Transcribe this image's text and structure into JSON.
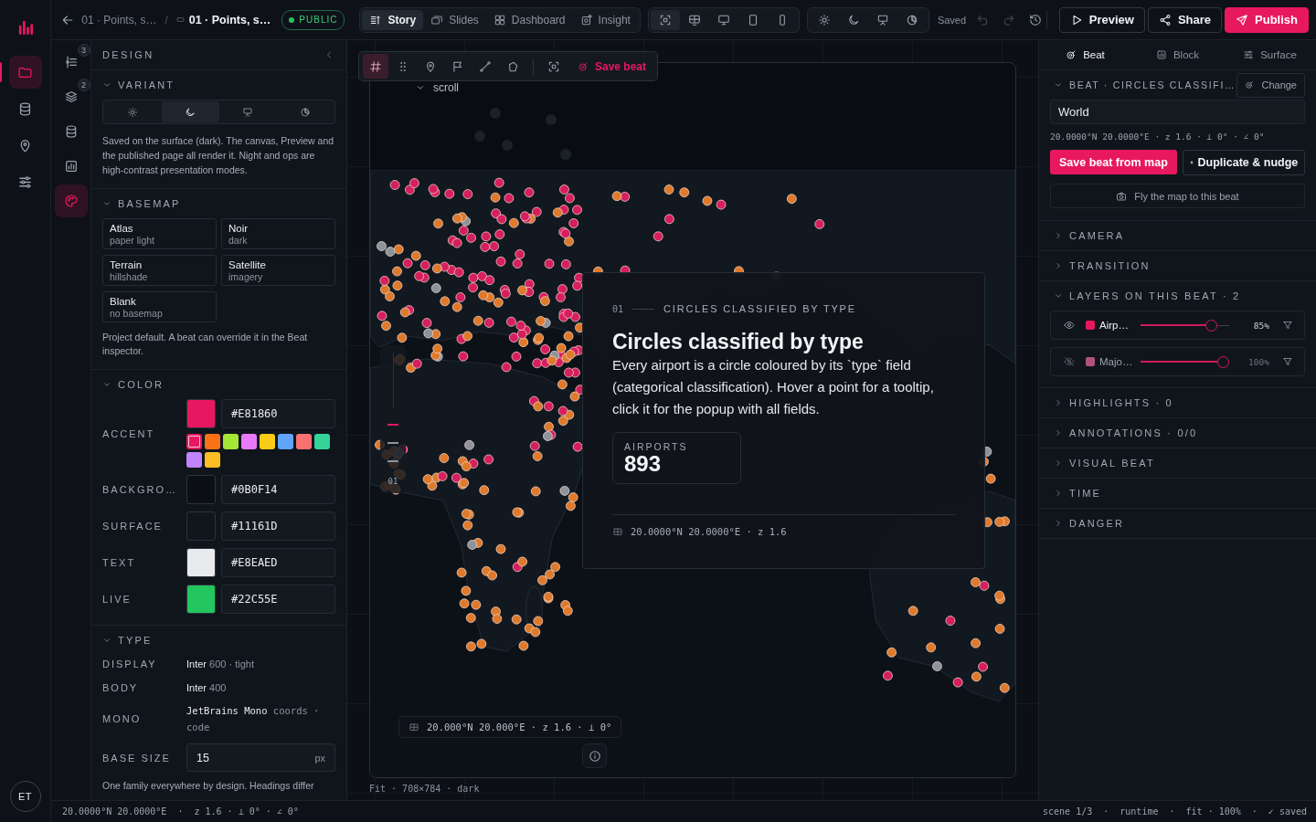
{
  "rail": {
    "items": [
      {
        "selected": true
      },
      {
        "selected": false
      },
      {
        "selected": false
      },
      {
        "selected": false
      }
    ],
    "avatar": "ET"
  },
  "topbar": {
    "parent": "01 · Points, s…",
    "separator": "/",
    "title": "01 · Points, s…",
    "badge": "PUBLIC",
    "modes": [
      {
        "label": "Story",
        "selected": true
      },
      {
        "label": "Slides",
        "selected": false
      },
      {
        "label": "Dashboard",
        "selected": false
      },
      {
        "label": "Insight",
        "selected": false
      }
    ],
    "devices": [
      {
        "selected": true
      },
      {
        "selected": false
      },
      {
        "selected": false
      },
      {
        "selected": false
      },
      {
        "selected": false
      }
    ],
    "save_state": "Saved",
    "undo": {
      "disabled": true
    },
    "redo": {
      "disabled": true
    },
    "actions": [
      {
        "kind": "preview",
        "label": "Preview"
      },
      {
        "kind": "share",
        "label": "Share"
      },
      {
        "kind": "publish",
        "label": "Publish"
      }
    ]
  },
  "tool_rail": [
    {
      "badge": "3",
      "selected": false
    },
    {
      "badge": "2",
      "selected": false
    },
    {
      "selected": false
    },
    {
      "selected": false
    },
    {
      "selected": true
    }
  ],
  "design": {
    "title": "DESIGN",
    "variant": {
      "title": "VARIANT",
      "expanded": true,
      "options": [
        {
          "selected": false
        },
        {
          "selected": true
        },
        {
          "selected": false
        },
        {
          "selected": false
        }
      ],
      "note": "Saved on the surface (dark). The canvas, Preview and the published page all render it. Night and ops are high-contrast presentation modes."
    },
    "basemap": {
      "title": "BASEMAP",
      "expanded": true,
      "options": [
        {
          "name": "Atlas",
          "detail": "paper light"
        },
        {
          "name": "Noir",
          "detail": "dark"
        },
        {
          "name": "Terrain",
          "detail": "hillshade"
        },
        {
          "name": "Satellite",
          "detail": "imagery"
        },
        {
          "name": "Blank",
          "detail": "no basemap"
        }
      ],
      "note": "Project default. A beat can override it in the Beat inspector."
    },
    "color": {
      "title": "COLOR",
      "expanded": true,
      "rows": [
        {
          "label": "ACCENT",
          "value": "#E81860",
          "color": "#e81860"
        },
        {
          "label": "BACKGRO…",
          "value": "#0B0F14",
          "color": "#0b0f14"
        },
        {
          "label": "SURFACE",
          "value": "#11161D",
          "color": "#11161d"
        },
        {
          "label": "TEXT",
          "value": "#E8EAED",
          "color": "#e8eaed"
        },
        {
          "label": "LIVE",
          "value": "#22C55E",
          "color": "#22c55e"
        }
      ],
      "palette": [
        {
          "color": "#e81860",
          "selected": true
        },
        {
          "color": "#f97316",
          "selected": false
        },
        {
          "color": "#a3e635",
          "selected": false
        },
        {
          "color": "#e879f9",
          "selected": false
        },
        {
          "color": "#facc15",
          "selected": false
        },
        {
          "color": "#60a5fa",
          "selected": false
        },
        {
          "color": "#f87171",
          "selected": false
        },
        {
          "color": "#34d399",
          "selected": false
        },
        {
          "color": "#c084fc",
          "selected": false
        },
        {
          "color": "#fbbf24",
          "selected": false
        }
      ]
    },
    "type": {
      "title": "TYPE",
      "expanded": true,
      "rows": [
        {
          "label": "DISPLAY",
          "kind": "sans",
          "font": "Inter",
          "detail": "600 · tight"
        },
        {
          "label": "BODY",
          "kind": "sans",
          "font": "Inter",
          "detail": "400"
        },
        {
          "label": "MONO",
          "kind": "mono",
          "font": "JetBrains Mono",
          "detail": "coords · code"
        }
      ],
      "base_size": {
        "label": "BASE SIZE",
        "value": "15",
        "unit": "px"
      },
      "note": "One family everywhere by design. Headings differ"
    }
  },
  "canvas": {
    "tools": [
      {
        "selected": true
      },
      {
        "selected": false
      },
      {
        "selected": false
      },
      {
        "selected": false
      },
      {
        "selected": false
      },
      {
        "selected": false
      }
    ],
    "save_label": "Save beat",
    "scroll_label": "scroll",
    "steps": [
      {
        "selected": true
      },
      {
        "selected": false
      },
      {
        "selected": false
      }
    ],
    "step_label": "01",
    "card": {
      "index": "01",
      "eyebrow": "CIRCLES CLASSIFIED BY TYPE",
      "title": "Circles classified by type",
      "body": "Every airport is a circle coloured by its `type` field (categorical classification). Hover a point for a tooltip, click it for the popup with all fields.",
      "stat": {
        "label": "AIRPORTS",
        "value": "893"
      },
      "coords": "20.0000°N 20.0000°E · z 1.6"
    },
    "coords_pill": "20.000°N 20.000°E · z 1.6 · ⊥ 0°",
    "frame_info": "Fit · 708×784 · dark"
  },
  "inspector": {
    "tabs": [
      {
        "label": "Beat",
        "selected": true
      },
      {
        "label": "Block",
        "selected": false
      },
      {
        "label": "Surface",
        "selected": false
      }
    ],
    "beat": {
      "title": "BEAT · CIRCLES CLASSIFI…",
      "expanded": true,
      "change_label": "Change",
      "name": "World",
      "coords": "20.0000°N 20.0000°E · z 1.6 · ⊥ 0° · ∠ 0°",
      "save_label": "Save beat from map",
      "duplicate_label": "Duplicate & nudge",
      "fly_label": "Fly the map to this beat"
    },
    "sections": [
      {
        "title": "CAMERA",
        "expanded": false
      },
      {
        "title": "TRANSITION",
        "expanded": false
      },
      {
        "title": "LAYERS ON THIS BEAT · 2",
        "expanded": true,
        "layers": [
          {
            "name": "Airp…",
            "color": "#e81860",
            "visible": true,
            "level": 0.85,
            "reading": "85%"
          },
          {
            "name": "Majo…",
            "color": "#b0527c",
            "visible": false,
            "level": 1,
            "reading": "100%"
          }
        ]
      },
      {
        "title": "HIGHLIGHTS · 0",
        "expanded": false
      },
      {
        "title": "ANNOTATIONS · 0/0",
        "expanded": false
      },
      {
        "title": "VISUAL BEAT",
        "expanded": false
      },
      {
        "title": "TIME",
        "expanded": false
      },
      {
        "title": "DANGER",
        "expanded": false
      }
    ]
  },
  "status_bar": {
    "left": "20.0000°N 20.0000°E  ·  z 1.6 · ⊥ 0° · ∠ 0°",
    "right": "scene 1/3  ·  runtime  ·  fit · 100%  ·  ✓ saved"
  }
}
